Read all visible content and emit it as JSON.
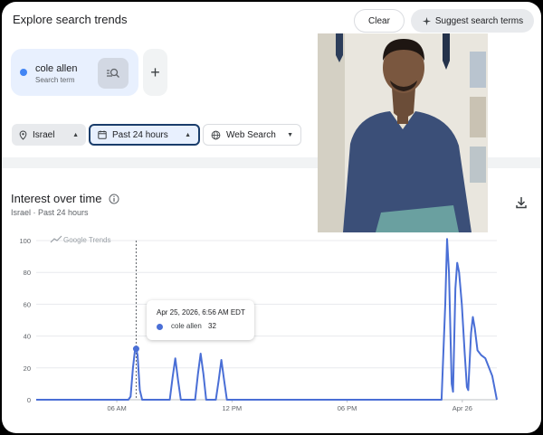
{
  "header": {
    "title": "Explore search trends",
    "clear_label": "Clear",
    "suggest_label": "Suggest search terms"
  },
  "term": {
    "name": "cole allen",
    "subtitle": "Search term",
    "color": "#4285f4"
  },
  "filters": {
    "location": "Israel",
    "time_range": "Past 24 hours",
    "search_type": "Web Search"
  },
  "section": {
    "title": "Interest over time",
    "subtitle": "Israel · Past 24 hours"
  },
  "watermark": "Google Trends",
  "tooltip": {
    "date": "Apr 25, 2026, 6:56 AM EDT",
    "term": "cole allen",
    "value": "32"
  },
  "chart_data": {
    "type": "line",
    "y_ticks": [
      "100",
      "80",
      "60",
      "40",
      "20",
      "0"
    ],
    "ylim": [
      0,
      100
    ],
    "x_ticks": [
      {
        "label": "06 AM",
        "frac": 0.175
      },
      {
        "label": "12 PM",
        "frac": 0.425
      },
      {
        "label": "06 PM",
        "frac": 0.675
      },
      {
        "label": "Apr 26",
        "frac": 0.925
      }
    ],
    "grid": "horizontal",
    "color": "#4a6fd6",
    "series": [
      {
        "name": "cole allen",
        "points": [
          [
            0.0,
            0
          ],
          [
            0.2,
            0
          ],
          [
            0.205,
            2
          ],
          [
            0.21,
            20
          ],
          [
            0.214,
            30
          ],
          [
            0.217,
            32
          ],
          [
            0.22,
            28
          ],
          [
            0.225,
            6
          ],
          [
            0.23,
            0
          ],
          [
            0.29,
            0
          ],
          [
            0.296,
            14
          ],
          [
            0.302,
            26
          ],
          [
            0.308,
            12
          ],
          [
            0.314,
            0
          ],
          [
            0.345,
            0
          ],
          [
            0.351,
            16
          ],
          [
            0.357,
            29
          ],
          [
            0.363,
            16
          ],
          [
            0.369,
            0
          ],
          [
            0.39,
            0
          ],
          [
            0.396,
            12
          ],
          [
            0.402,
            25
          ],
          [
            0.408,
            12
          ],
          [
            0.414,
            0
          ],
          [
            0.88,
            0
          ],
          [
            0.888,
            60
          ],
          [
            0.892,
            101
          ],
          [
            0.896,
            80
          ],
          [
            0.902,
            10
          ],
          [
            0.905,
            5
          ],
          [
            0.91,
            70
          ],
          [
            0.914,
            86
          ],
          [
            0.918,
            80
          ],
          [
            0.924,
            60
          ],
          [
            0.93,
            30
          ],
          [
            0.935,
            8
          ],
          [
            0.938,
            6
          ],
          [
            0.944,
            42
          ],
          [
            0.948,
            52
          ],
          [
            0.952,
            45
          ],
          [
            0.958,
            31
          ],
          [
            0.966,
            28
          ],
          [
            0.975,
            26
          ],
          [
            0.99,
            15
          ],
          [
            1.0,
            0
          ]
        ],
        "highlight": [
          0.217,
          32
        ]
      }
    ]
  }
}
